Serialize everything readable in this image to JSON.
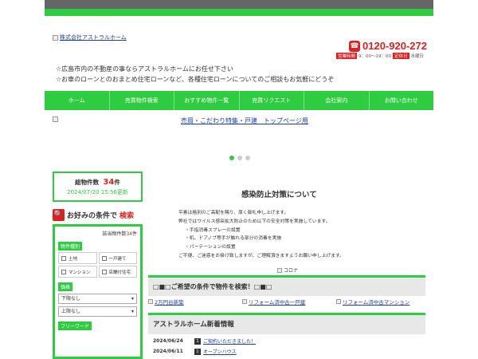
{
  "header": {
    "logo_alt": "株式会社アストラルホーム",
    "phone": "0120-920-272",
    "hours_tag": "営業時間",
    "hours": "9：00～19：00",
    "holiday_tag": "定休日",
    "holiday": "水曜日",
    "intro_1": "☆広島市内の不動産の事ならアストラルホームにお任せ下さい",
    "intro_2": "☆お車のローンとのおまとめ住宅ローンなど、各種住宅ローンについてのご相談もお気軽にどうぞ"
  },
  "nav": [
    "ホーム",
    "売買物件検索",
    "おすすめ物件一覧",
    "売買リクエスト",
    "会社案内",
    "お問い合わせ"
  ],
  "banner": {
    "alt": "売買・こだわり特集・戸建　トップページ用"
  },
  "counts": {
    "label": "総物件数",
    "number": "34",
    "unit": "件",
    "updated": "2024/07/20 15:56更新"
  },
  "search": {
    "title_1": "お好みの条件で",
    "title_2": "検索",
    "total_label": "該当物件数",
    "total_num": "34",
    "total_unit": "件",
    "type_label": "物件種別",
    "types": [
      "土地",
      "一戸建て",
      "マンション",
      "店舗付住宅"
    ],
    "price_label": "価格",
    "price_min": "下限なし",
    "price_max": "上限なし",
    "free_label": "フリーワード"
  },
  "article": {
    "title": "感染防止対策について",
    "line1": "平素は格別のご高配を賜り、厚く御礼申し上げます。",
    "line2": "弊社ではウイルス感染拡大防止のため以下の安全対策を実施しています。",
    "b1": "・手指消毒スプレーの設置",
    "b2": "・机、ドアノブ等手が触れる部分の消毒を実施",
    "b3": "・パーテーションの設置",
    "line3": "ご不便、ご迷惑をお掛け致しますが、ご理解頂きますようお願い申し上げます。",
    "image_alt": "コロナ"
  },
  "conditions": {
    "title": "□■□ご希望の条件で物件を検索！□■□",
    "links": [
      "2万円台新築",
      "リフォーム済中古一戸建",
      "リフォーム済中古マンション"
    ]
  },
  "news": {
    "title": "アストラルホーム新着情報",
    "items": [
      {
        "date": "2024/06/24",
        "num": "1",
        "text": "ご契約いただきました！"
      },
      {
        "date": "2024/06/11",
        "num": "1",
        "text": "オープンハウス"
      }
    ]
  }
}
